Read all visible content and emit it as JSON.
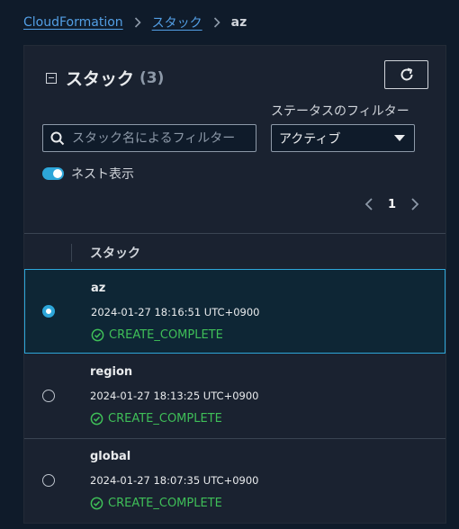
{
  "breadcrumb": {
    "root": "CloudFormation",
    "section": "スタック",
    "current": "az"
  },
  "panel": {
    "title": "スタック",
    "count": "(3)",
    "search_placeholder": "スタック名によるフィルター",
    "filter_label": "ステータスのフィルター",
    "filter_value": "アクティブ",
    "toggle_label": "ネスト表示",
    "page": "1",
    "column_header": "スタック"
  },
  "stacks": [
    {
      "name": "az",
      "date": "2024-01-27 18:16:51 UTC+0900",
      "status": "CREATE_COMPLETE",
      "selected": true
    },
    {
      "name": "region",
      "date": "2024-01-27 18:13:25 UTC+0900",
      "status": "CREATE_COMPLETE",
      "selected": false
    },
    {
      "name": "global",
      "date": "2024-01-27 18:07:35 UTC+0900",
      "status": "CREATE_COMPLETE",
      "selected": false
    }
  ],
  "colors": {
    "accent": "#2da6d9",
    "success": "#3fbf58",
    "link": "#539fe5"
  }
}
